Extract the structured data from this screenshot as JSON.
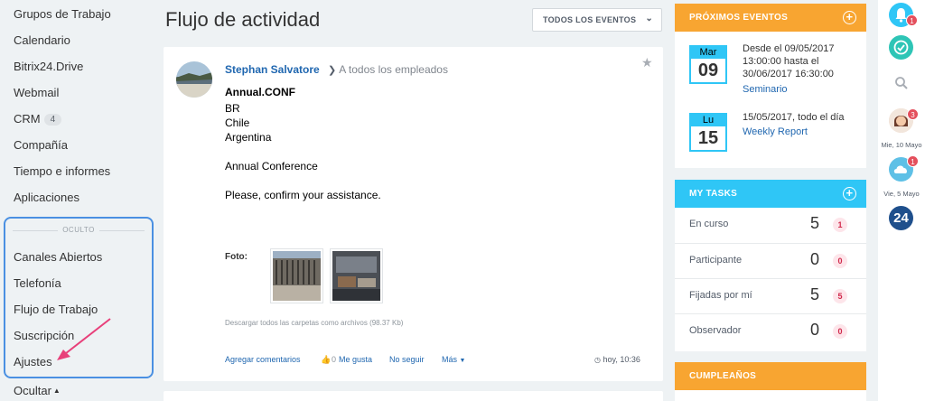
{
  "sidebar": {
    "items": [
      {
        "label": "Grupos de Trabajo"
      },
      {
        "label": "Calendario"
      },
      {
        "label": "Bitrix24.Drive"
      },
      {
        "label": "Webmail"
      },
      {
        "label": "CRM",
        "badge": "4"
      },
      {
        "label": "Compañía"
      },
      {
        "label": "Tiempo e informes"
      },
      {
        "label": "Aplicaciones"
      }
    ],
    "hidden_label": "OCULTO",
    "hidden_items": [
      {
        "label": "Canales Abiertos"
      },
      {
        "label": "Telefonía"
      },
      {
        "label": "Flujo de Trabajo"
      },
      {
        "label": "Suscripción"
      },
      {
        "label": "Ajustes"
      }
    ],
    "hide_toggle": "Ocultar"
  },
  "header": {
    "title": "Flujo de actividad",
    "filter_label": "TODOS LOS EVENTOS"
  },
  "post": {
    "author": "Stephan Salvatore",
    "destination": "A todos los empleados",
    "title": "Annual.CONF",
    "lines": [
      "BR",
      "Chile",
      "Argentina",
      "Annual Conference",
      "Please, confirm your assistance."
    ],
    "photo_label": "Foto:",
    "download_note": "Descargar todos las carpetas como archivos (98.37 Kb)",
    "actions": {
      "comment": "Agregar comentarios",
      "like_count": "0",
      "like": "Me gusta",
      "unfollow": "No seguir",
      "more": "Más"
    },
    "time": "hoy, 10:36"
  },
  "events_widget": {
    "title": "PRÓXIMOS EVENTOS",
    "events": [
      {
        "month": "Mar",
        "day": "09",
        "lines": [
          "Desde el 09/05/2017",
          "13:00:00 hasta el",
          "30/06/2017 16:30:00"
        ],
        "name": "Seminario"
      },
      {
        "month": "Lu",
        "day": "15",
        "lines": [
          "15/05/2017, todo el día"
        ],
        "name": "Weekly Report"
      }
    ]
  },
  "tasks_widget": {
    "title": "MY TASKS",
    "rows": [
      {
        "label": "En curso",
        "count": "5",
        "badge": "1"
      },
      {
        "label": "Participante",
        "count": "0",
        "badge": "0"
      },
      {
        "label": "Fijadas por mí",
        "count": "5",
        "badge": "5"
      },
      {
        "label": "Observador",
        "count": "0",
        "badge": "0"
      }
    ]
  },
  "birthday_widget": {
    "title": "CUMPLEAÑOS"
  },
  "rightbar": {
    "notif_count": "1",
    "chat1_count": "3",
    "chat1_date": "Mie, 10 Mayo",
    "chat2_count": "1",
    "chat2_date": "Vie, 5 Mayo",
    "logo_text": "24"
  },
  "colors": {
    "orange": "#f8a531",
    "cyan": "#2fc6f6",
    "link": "#2067b0",
    "hidden_border": "#4a90e2",
    "arrow": "#e8407a"
  }
}
